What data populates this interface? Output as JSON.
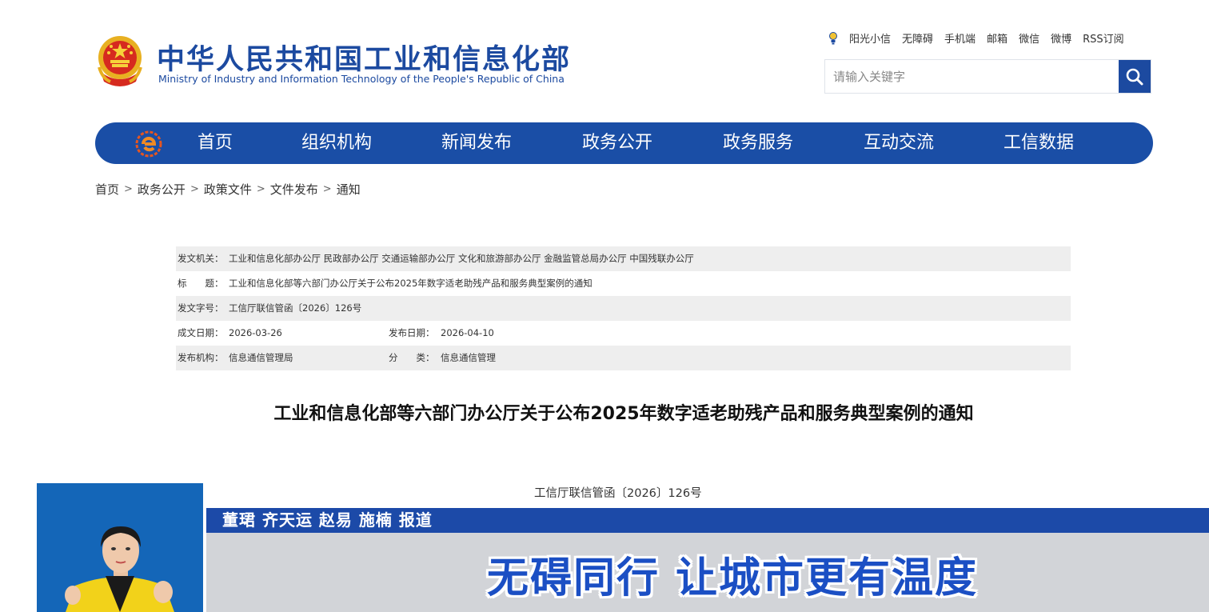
{
  "header": {
    "title_cn": "中华人民共和国工业和信息化部",
    "title_en": "Ministry of Industry and Information Technology of the People's Republic of China",
    "toplinks": [
      "阳光小信",
      "无障碍",
      "手机端",
      "邮箱",
      "微信",
      "微博",
      "RSS订阅"
    ],
    "search_placeholder": "请输入关键字",
    "emblem_icon": "national-emblem-icon",
    "brand_color": "#1c4aa0"
  },
  "nav": {
    "items": [
      "首页",
      "组织机构",
      "新闻发布",
      "政务公开",
      "政务服务",
      "互动交流",
      "工信数据"
    ],
    "bg_color": "#1a4ea6"
  },
  "breadcrumb": [
    "首页",
    "政务公开",
    "政策文件",
    "文件发布",
    "通知"
  ],
  "doc_info": {
    "issuer_label": "发文机关：",
    "issuer_value": "工业和信息化部办公厅 民政部办公厅 交通运输部办公厅 文化和旅游部办公厅 金融监管总局办公厅 中国残联办公厅",
    "title_label": "标　　题：",
    "title_value": "工业和信息化部等六部门办公厅关于公布2025年数字适老助残产品和服务典型案例的通知",
    "docno_label": "发文字号：",
    "docno_value": "工信厅联信管函〔2026〕126号",
    "created_label": "成文日期：",
    "created_value": "2026-03-26",
    "published_label": "发布日期：",
    "published_value": "2026-04-10",
    "org_label": "发布机构：",
    "org_value": "信息通信管理局",
    "category_label": "分　　类：",
    "category_value": "信息通信管理"
  },
  "document": {
    "title": "工业和信息化部等六部门办公厅关于公布2025年数字适老助残产品和服务典型案例的通知",
    "number": "工信厅联信管函〔2026〕126号"
  },
  "overlay": {
    "credit": "董珺 齐天运 赵易 施楠 报道",
    "headline": "无碍同行 让城市更有温度",
    "credit_bar_color": "#1c4aa8",
    "headline_color": "#1b4fc4"
  }
}
